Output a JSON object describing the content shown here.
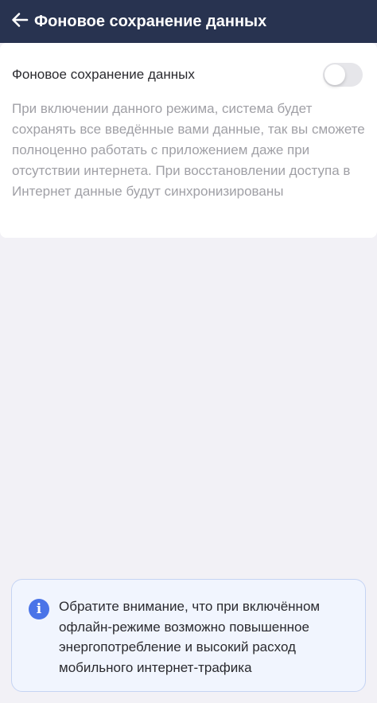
{
  "header": {
    "title": "Фоновое сохранение данных",
    "back_icon": "arrow-left-icon",
    "background": "#283350"
  },
  "setting": {
    "label": "Фоновое сохранение данных",
    "enabled": false,
    "description": "При включении данного режима, система будет сохранять все введённые вами данные, так вы сможете полноценно работать с приложением даже при отсутствии интернета. При восстановлении доступа в Интернет данные будут синхронизированы"
  },
  "notice": {
    "icon": "info-icon",
    "icon_glyph": "i",
    "accent": "#4a74e8",
    "text": "Обратите внимание, что при включённом офлайн-режиме возможно повышенное энергопотребление и высокий расход мобильного интернет-трафика"
  }
}
